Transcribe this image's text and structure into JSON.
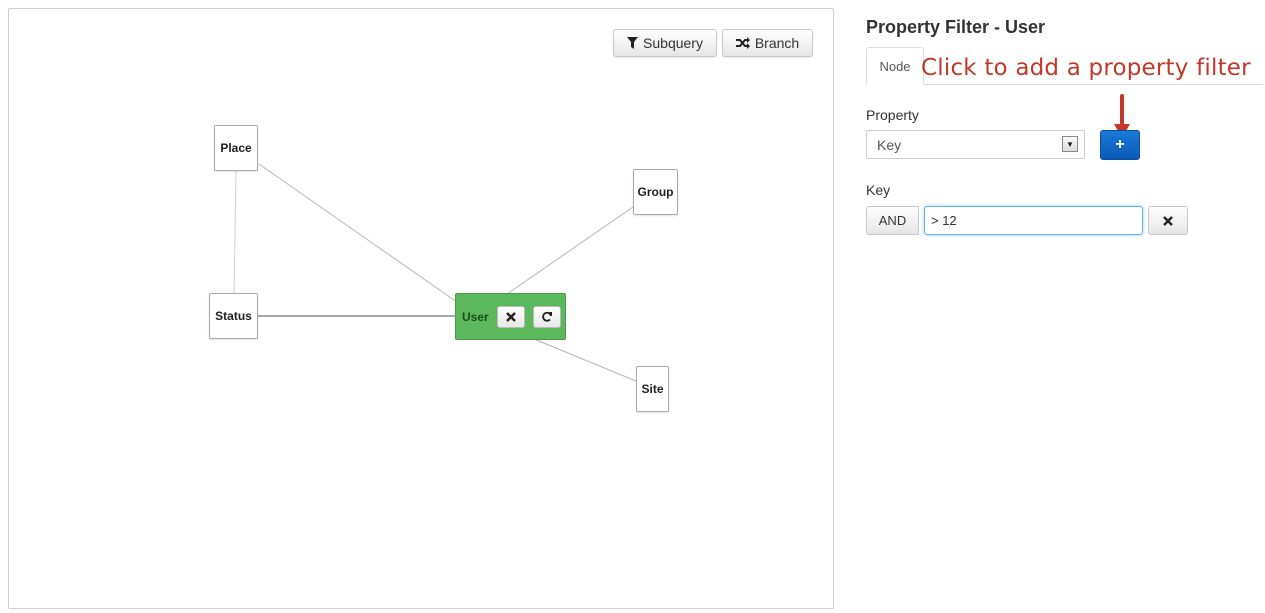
{
  "toolbar": {
    "subquery_label": "Subquery",
    "subquery_icon": "filter-icon",
    "branch_label": "Branch",
    "branch_icon": "shuffle-icon"
  },
  "graph": {
    "nodes": {
      "place": "Place",
      "status": "Status",
      "group": "Group",
      "site": "Site",
      "user": "User"
    },
    "user_remove_icon": "close-icon",
    "user_refresh_icon": "refresh-icon",
    "user_color": "#5cb85c"
  },
  "panel": {
    "title": "Property Filter - User",
    "tab_label": "Node",
    "annotation": "Click to add a property filter",
    "annotation_color": "#c0392b",
    "property_label": "Property",
    "property_selected": "Key",
    "add_button_label": "+",
    "key_label": "Key",
    "operator_label": "AND",
    "filter_value": "> 12",
    "remove_icon": "close-icon"
  }
}
